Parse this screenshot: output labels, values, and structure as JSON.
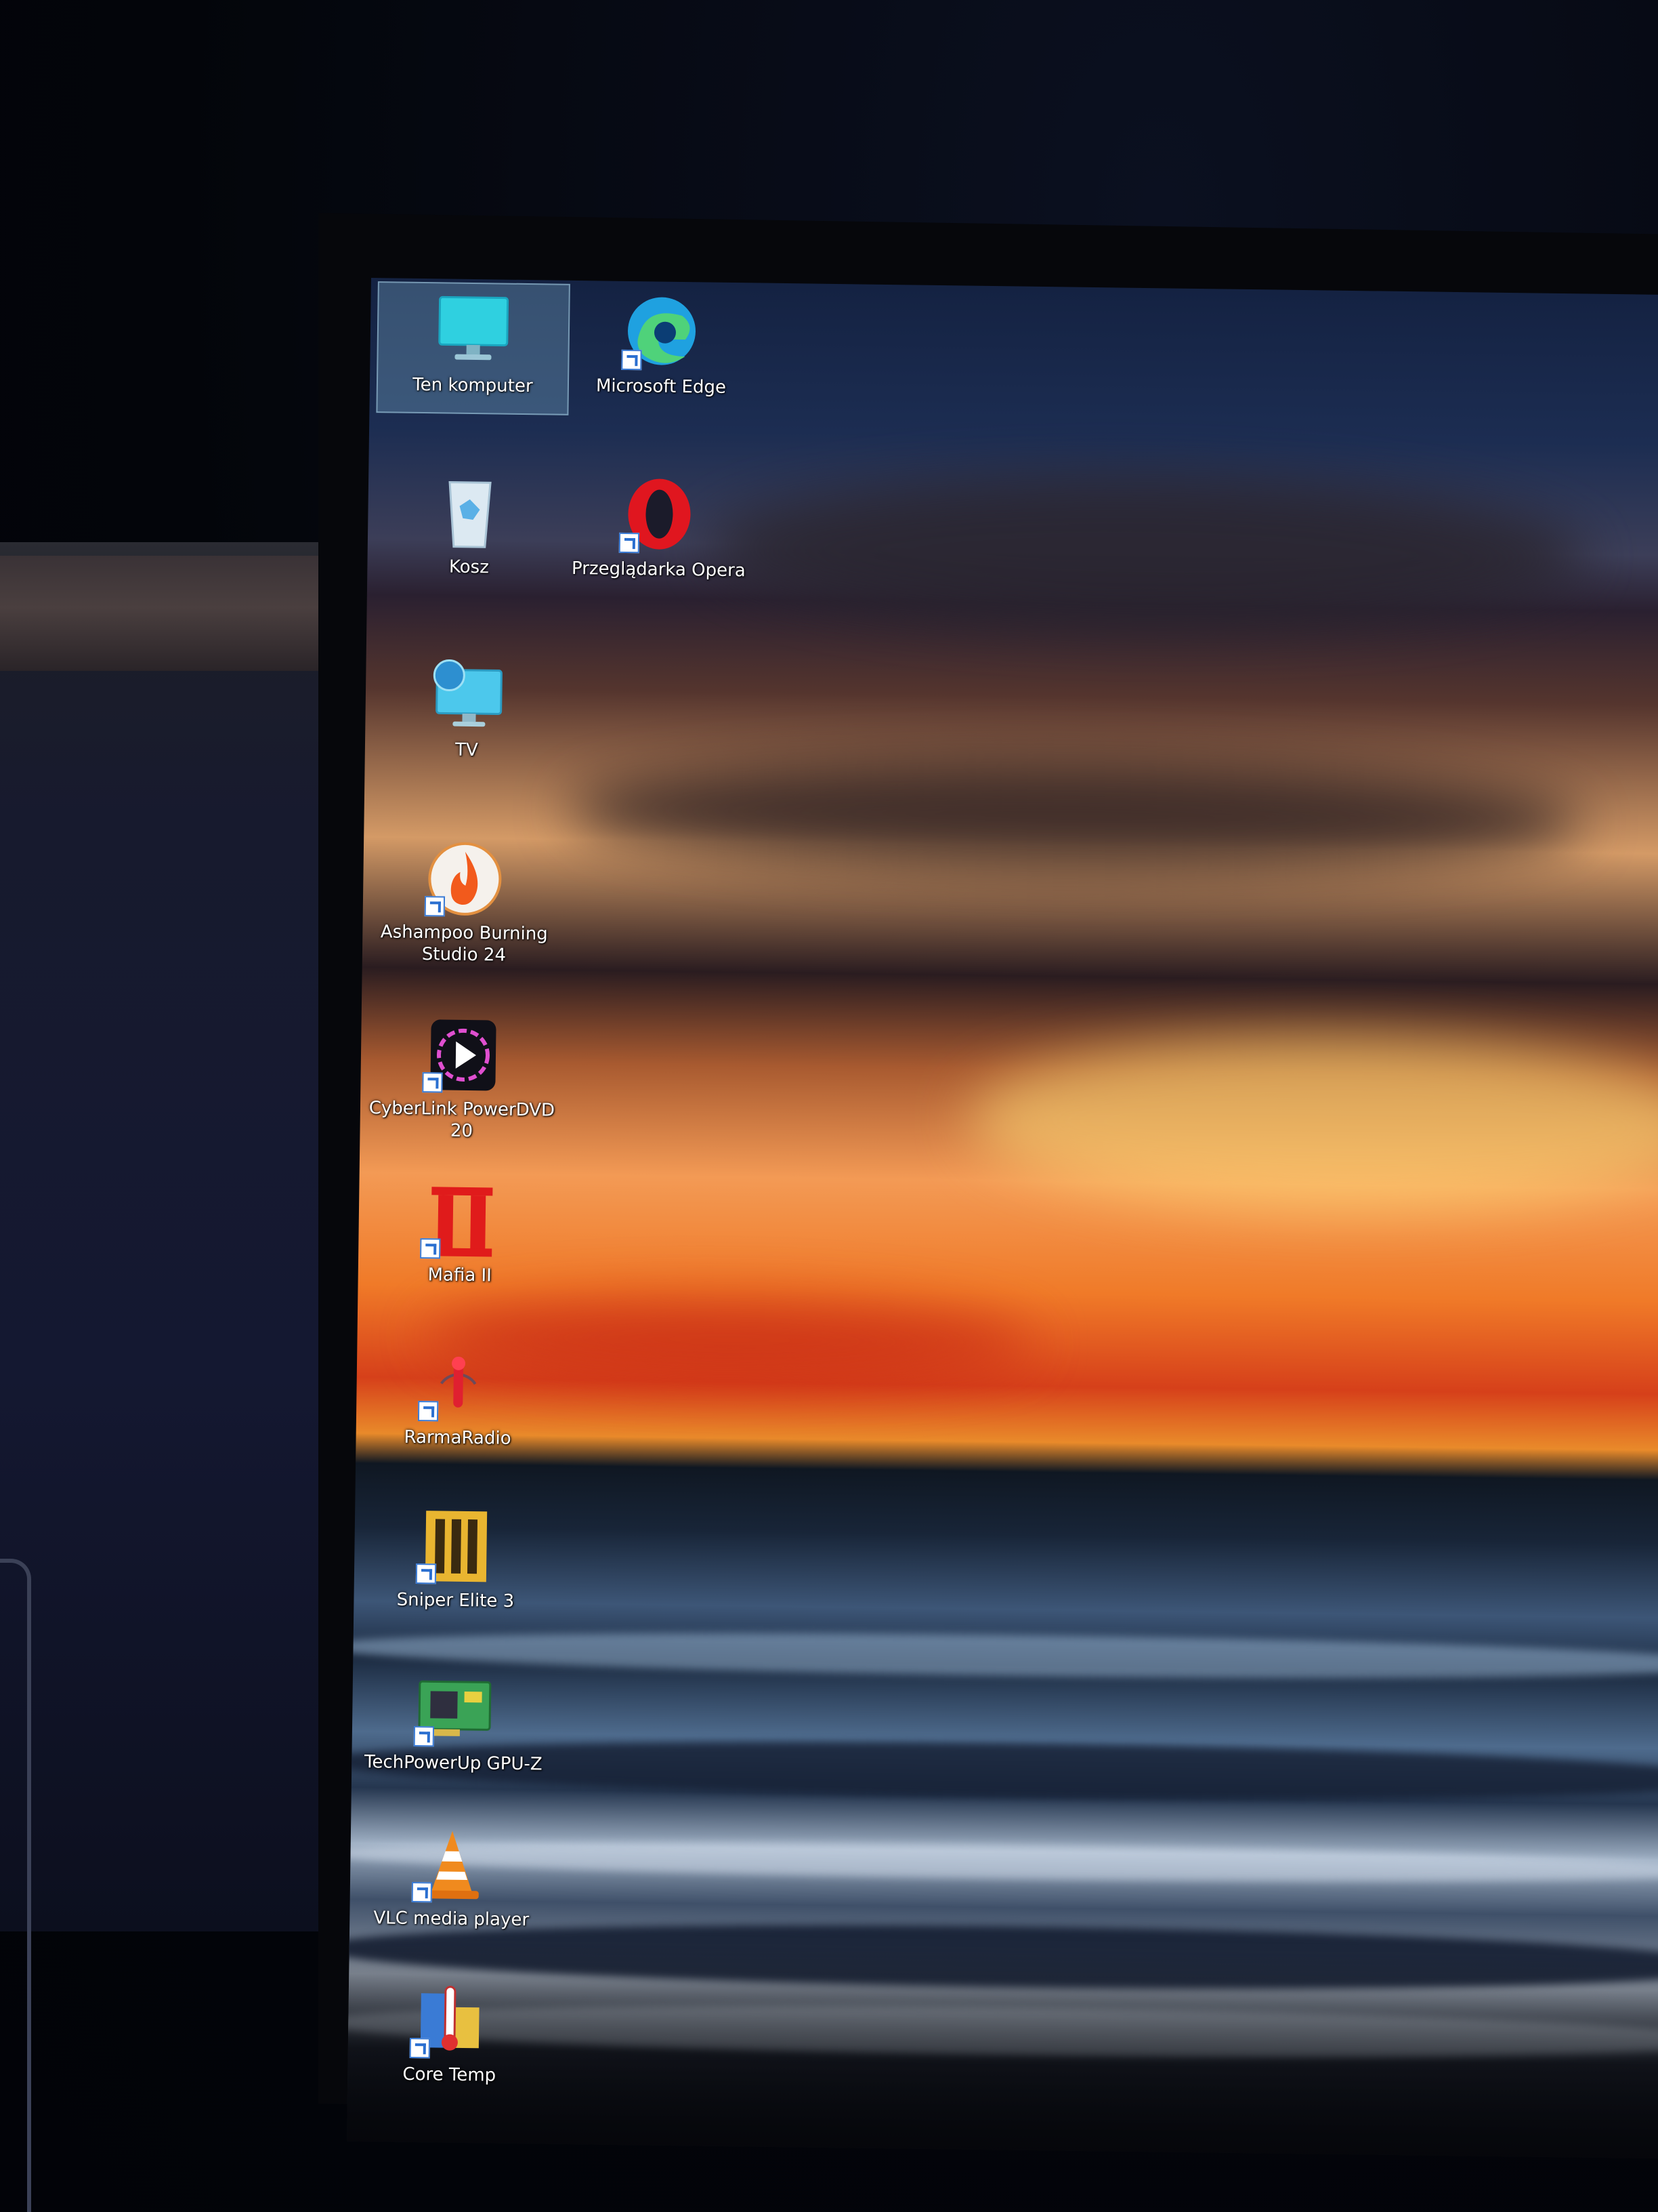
{
  "desktop": {
    "icons": [
      {
        "label": "Ten komputer",
        "icon": "monitor-icon",
        "selected": true
      },
      {
        "label": "Microsoft Edge",
        "icon": "edge-icon"
      },
      {
        "label": "Kosz",
        "icon": "recycle-bin-icon"
      },
      {
        "label": "Przeglądarka Opera",
        "icon": "opera-icon"
      },
      {
        "label": "TV",
        "icon": "network-monitor-icon"
      },
      {
        "label": "Ashampoo Burning\nStudio 24",
        "icon": "burning-disc-icon"
      },
      {
        "label": "CyberLink PowerDVD\n20",
        "icon": "powerdvd-icon"
      },
      {
        "label": "Mafia II",
        "icon": "mafia-ii-icon"
      },
      {
        "label": "RarmaRadio",
        "icon": "radio-icon"
      },
      {
        "label": "Sniper Elite 3",
        "icon": "sniper-elite-icon"
      },
      {
        "label": "TechPowerUp GPU-Z",
        "icon": "gpu-card-icon"
      },
      {
        "label": "VLC media player",
        "icon": "vlc-cone-icon"
      },
      {
        "label": "Core Temp",
        "icon": "thermometer-icon"
      }
    ]
  },
  "colors": {
    "selection": "#78aac8",
    "label_text": "#ffffff",
    "edge": "#1fa1e0",
    "opera": "#e0161f",
    "mafia": "#e01b1b",
    "vlc": "#f08a1e"
  }
}
